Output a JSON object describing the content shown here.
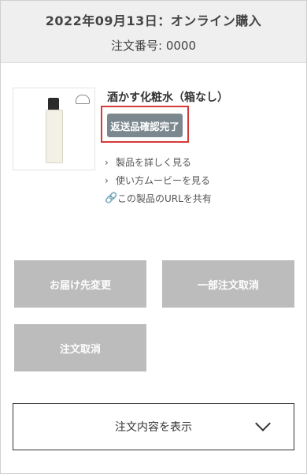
{
  "header": {
    "date_line": "2022年09月13日：オンライン購入",
    "order_number": "注文番号: 0000"
  },
  "product": {
    "name": "酒かす化粧水（箱なし）",
    "status_button": "返送品確認完了",
    "links": [
      {
        "icon": "chevron-right-icon",
        "label": "製品を詳しく見る"
      },
      {
        "icon": "chevron-right-icon",
        "label": "使い方ムービーを見る"
      },
      {
        "icon": "link-icon",
        "label": "この製品のURLを共有"
      }
    ]
  },
  "actions": {
    "change_address": "お届け先変更",
    "partial_cancel": "一部注文取消",
    "cancel_order": "注文取消"
  },
  "details": {
    "label": "注文内容を表示"
  },
  "colors": {
    "header_bg": "#efefef",
    "status_button": "#7c8890",
    "highlight_border": "#d43a3a",
    "disabled_button": "#bcbcbc"
  }
}
